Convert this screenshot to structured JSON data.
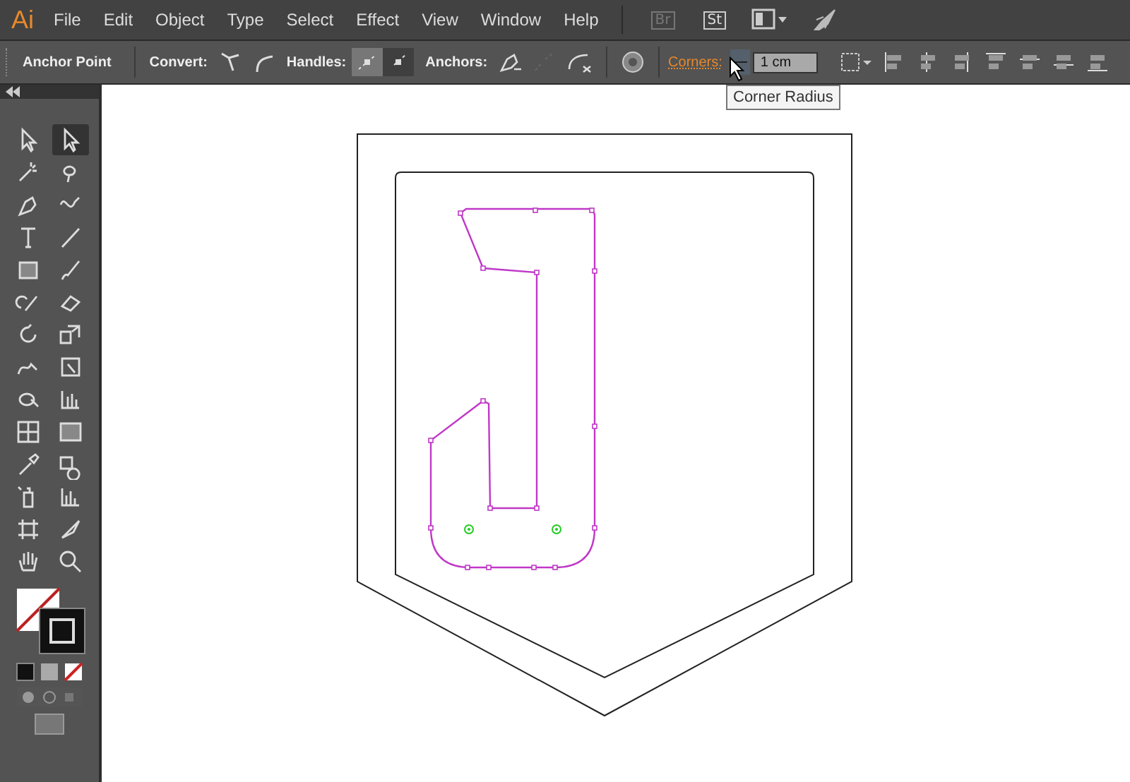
{
  "app": {
    "logo": "Ai"
  },
  "menu": [
    "File",
    "Edit",
    "Object",
    "Type",
    "Select",
    "Effect",
    "View",
    "Window",
    "Help"
  ],
  "app_bar": [
    {
      "kind": "br",
      "label": "Br"
    },
    {
      "kind": "st",
      "label": "St"
    },
    {
      "kind": "layout"
    },
    {
      "kind": "rocket"
    }
  ],
  "control_bar": {
    "title": "Anchor Point",
    "convert_label": "Convert:",
    "handles_label": "Handles:",
    "handles": [
      {
        "selected": true
      },
      {
        "selected": false
      }
    ],
    "anchors_label": "Anchors:",
    "corners_label": "Corners:",
    "corners_value": "1 cm"
  },
  "tooltip": "Corner Radius",
  "toolbar": {
    "tools": [
      {
        "kind": "selection",
        "selected": false
      },
      {
        "kind": "direct-selection",
        "selected": true
      },
      {
        "kind": "magic-wand",
        "selected": false
      },
      {
        "kind": "lasso",
        "selected": false
      },
      {
        "kind": "pen",
        "selected": false
      },
      {
        "kind": "curvature",
        "selected": false
      },
      {
        "kind": "type",
        "selected": false
      },
      {
        "kind": "line",
        "selected": false
      },
      {
        "kind": "rectangle",
        "selected": false
      },
      {
        "kind": "brush",
        "selected": false
      },
      {
        "kind": "shaper",
        "selected": false
      },
      {
        "kind": "eraser",
        "selected": false
      },
      {
        "kind": "rotate",
        "selected": false
      },
      {
        "kind": "scale",
        "selected": false
      },
      {
        "kind": "warp",
        "selected": false
      },
      {
        "kind": "free-transform",
        "selected": false
      },
      {
        "kind": "shape-builder",
        "selected": false
      },
      {
        "kind": "graph-3d",
        "selected": false
      },
      {
        "kind": "mesh",
        "selected": false
      },
      {
        "kind": "gradient",
        "selected": false
      },
      {
        "kind": "eyedropper",
        "selected": false
      },
      {
        "kind": "blend",
        "selected": false
      },
      {
        "kind": "symbol-sprayer",
        "selected": false
      },
      {
        "kind": "column-graph",
        "selected": false
      },
      {
        "kind": "artboard",
        "selected": false
      },
      {
        "kind": "slice",
        "selected": false
      },
      {
        "kind": "hand",
        "selected": false
      },
      {
        "kind": "zoom",
        "selected": false
      }
    ]
  }
}
